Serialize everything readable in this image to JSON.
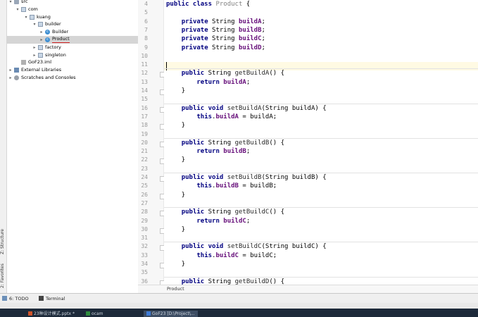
{
  "left_strip": {
    "structure": "Z: Structure",
    "favorites": "2: Favorites"
  },
  "project_tree": [
    {
      "label": "src",
      "level": 0,
      "kind": "folder",
      "expanded": true
    },
    {
      "label": "com",
      "level": 1,
      "kind": "pkg",
      "expanded": true
    },
    {
      "label": "kuang",
      "level": 2,
      "kind": "pkg",
      "expanded": true
    },
    {
      "label": "builder",
      "level": 3,
      "kind": "pkg",
      "expanded": true
    },
    {
      "label": "Builder",
      "level": 4,
      "kind": "class",
      "expanded": false
    },
    {
      "label": "Product",
      "level": 4,
      "kind": "class",
      "expanded": false,
      "selected": true
    },
    {
      "label": "factory",
      "level": 3,
      "kind": "pkg",
      "expanded": false
    },
    {
      "label": "singleton",
      "level": 3,
      "kind": "pkg",
      "expanded": false
    },
    {
      "label": "GoF23.iml",
      "level": 1,
      "kind": "iml"
    },
    {
      "label": "External Libraries",
      "level": 0,
      "kind": "lib",
      "expanded": false
    },
    {
      "label": "Scratches and Consoles",
      "level": 0,
      "kind": "scr",
      "expanded": false
    }
  ],
  "editor": {
    "lines": [
      {
        "no": "4",
        "code": "public class Product {",
        "tokens": [
          [
            "kw",
            "public class "
          ],
          [
            "",
            "Product {"
          ]
        ]
      },
      {
        "no": "5",
        "code": ""
      },
      {
        "no": "6",
        "tokens": [
          [
            "",
            "    "
          ],
          [
            "kw",
            "private "
          ],
          [
            "",
            "String "
          ],
          [
            "fld",
            "buildA"
          ],
          [
            "",
            ";"
          ]
        ]
      },
      {
        "no": "7",
        "tokens": [
          [
            "",
            "    "
          ],
          [
            "kw",
            "private "
          ],
          [
            "",
            "String "
          ],
          [
            "fld",
            "buildB"
          ],
          [
            "",
            ";"
          ]
        ]
      },
      {
        "no": "8",
        "tokens": [
          [
            "",
            "    "
          ],
          [
            "kw",
            "private "
          ],
          [
            "",
            "String "
          ],
          [
            "fld",
            "buildC"
          ],
          [
            "",
            ";"
          ]
        ]
      },
      {
        "no": "9",
        "tokens": [
          [
            "",
            "    "
          ],
          [
            "kw",
            "private "
          ],
          [
            "",
            "String "
          ],
          [
            "fld",
            "buildD"
          ],
          [
            "",
            ";"
          ]
        ]
      },
      {
        "no": "10",
        "tokens": []
      },
      {
        "no": "11",
        "tokens": []
      },
      {
        "no": "12",
        "tokens": [
          [
            "",
            "    "
          ],
          [
            "kw",
            "public "
          ],
          [
            "",
            "String "
          ],
          [
            "mth",
            "getBuildA"
          ],
          [
            "",
            "() {"
          ]
        ]
      },
      {
        "no": "13",
        "tokens": [
          [
            "",
            "        "
          ],
          [
            "kw",
            "return "
          ],
          [
            "fld",
            "buildA"
          ],
          [
            "",
            ";"
          ]
        ]
      },
      {
        "no": "14",
        "tokens": [
          [
            "",
            "    }"
          ]
        ]
      },
      {
        "no": "15",
        "tokens": []
      },
      {
        "no": "16",
        "tokens": [
          [
            "",
            "    "
          ],
          [
            "kw",
            "public void "
          ],
          [
            "mth",
            "setBuildA"
          ],
          [
            "",
            "(String buildA) {"
          ]
        ]
      },
      {
        "no": "17",
        "tokens": [
          [
            "",
            "        "
          ],
          [
            "kw",
            "this"
          ],
          [
            "",
            "."
          ],
          [
            "fld",
            "buildA"
          ],
          [
            "",
            " = buildA;"
          ]
        ]
      },
      {
        "no": "18",
        "tokens": [
          [
            "",
            "    }"
          ]
        ]
      },
      {
        "no": "19",
        "tokens": []
      },
      {
        "no": "20",
        "tokens": [
          [
            "",
            "    "
          ],
          [
            "kw",
            "public "
          ],
          [
            "",
            "String "
          ],
          [
            "mth",
            "getBuildB"
          ],
          [
            "",
            "() {"
          ]
        ]
      },
      {
        "no": "21",
        "tokens": [
          [
            "",
            "        "
          ],
          [
            "kw",
            "return "
          ],
          [
            "fld",
            "buildB"
          ],
          [
            "",
            ";"
          ]
        ]
      },
      {
        "no": "22",
        "tokens": [
          [
            "",
            "    }"
          ]
        ]
      },
      {
        "no": "23",
        "tokens": []
      },
      {
        "no": "24",
        "tokens": [
          [
            "",
            "    "
          ],
          [
            "kw",
            "public void "
          ],
          [
            "mth",
            "setBuildB"
          ],
          [
            "",
            "(String buildB) {"
          ]
        ]
      },
      {
        "no": "25",
        "tokens": [
          [
            "",
            "        "
          ],
          [
            "kw",
            "this"
          ],
          [
            "",
            "."
          ],
          [
            "fld",
            "buildB"
          ],
          [
            "",
            " = buildB;"
          ]
        ]
      },
      {
        "no": "26",
        "tokens": [
          [
            "",
            "    }"
          ]
        ]
      },
      {
        "no": "27",
        "tokens": []
      },
      {
        "no": "28",
        "tokens": [
          [
            "",
            "    "
          ],
          [
            "kw",
            "public "
          ],
          [
            "",
            "String "
          ],
          [
            "mth",
            "getBuildC"
          ],
          [
            "",
            "() {"
          ]
        ]
      },
      {
        "no": "29",
        "tokens": [
          [
            "",
            "        "
          ],
          [
            "kw",
            "return "
          ],
          [
            "fld",
            "buildC"
          ],
          [
            "",
            ";"
          ]
        ]
      },
      {
        "no": "30",
        "tokens": [
          [
            "",
            "    }"
          ]
        ]
      },
      {
        "no": "31",
        "tokens": []
      },
      {
        "no": "32",
        "tokens": [
          [
            "",
            "    "
          ],
          [
            "kw",
            "public void "
          ],
          [
            "mth",
            "setBuildC"
          ],
          [
            "",
            "(String buildC) {"
          ]
        ]
      },
      {
        "no": "33",
        "tokens": [
          [
            "",
            "        "
          ],
          [
            "kw",
            "this"
          ],
          [
            "",
            "."
          ],
          [
            "fld",
            "buildC"
          ],
          [
            "",
            " = buildC;"
          ]
        ]
      },
      {
        "no": "34",
        "tokens": [
          [
            "",
            "    }"
          ]
        ]
      },
      {
        "no": "35",
        "tokens": []
      },
      {
        "no": "36",
        "tokens": [
          [
            "",
            "    "
          ],
          [
            "kw",
            "public "
          ],
          [
            "",
            "String "
          ],
          [
            "mth",
            "getBuildD"
          ],
          [
            "",
            "() {"
          ]
        ]
      }
    ],
    "breadcrumb": "Product"
  },
  "bottom_bar": {
    "todo": "6: TODO",
    "terminal": "Terminal"
  },
  "taskbar": [
    {
      "label": "23种设计模式.pptx *",
      "icon_color": "#d0552b"
    },
    {
      "label": "ocam",
      "icon_color": "#2f8c3e"
    },
    {
      "label": "GoF23 [D:\\Project\\...",
      "icon_color": "#3e7bd6",
      "active": true
    }
  ],
  "colors": {
    "keyword": "#000080",
    "field": "#660e7a",
    "selection": "#d5d5d5"
  }
}
